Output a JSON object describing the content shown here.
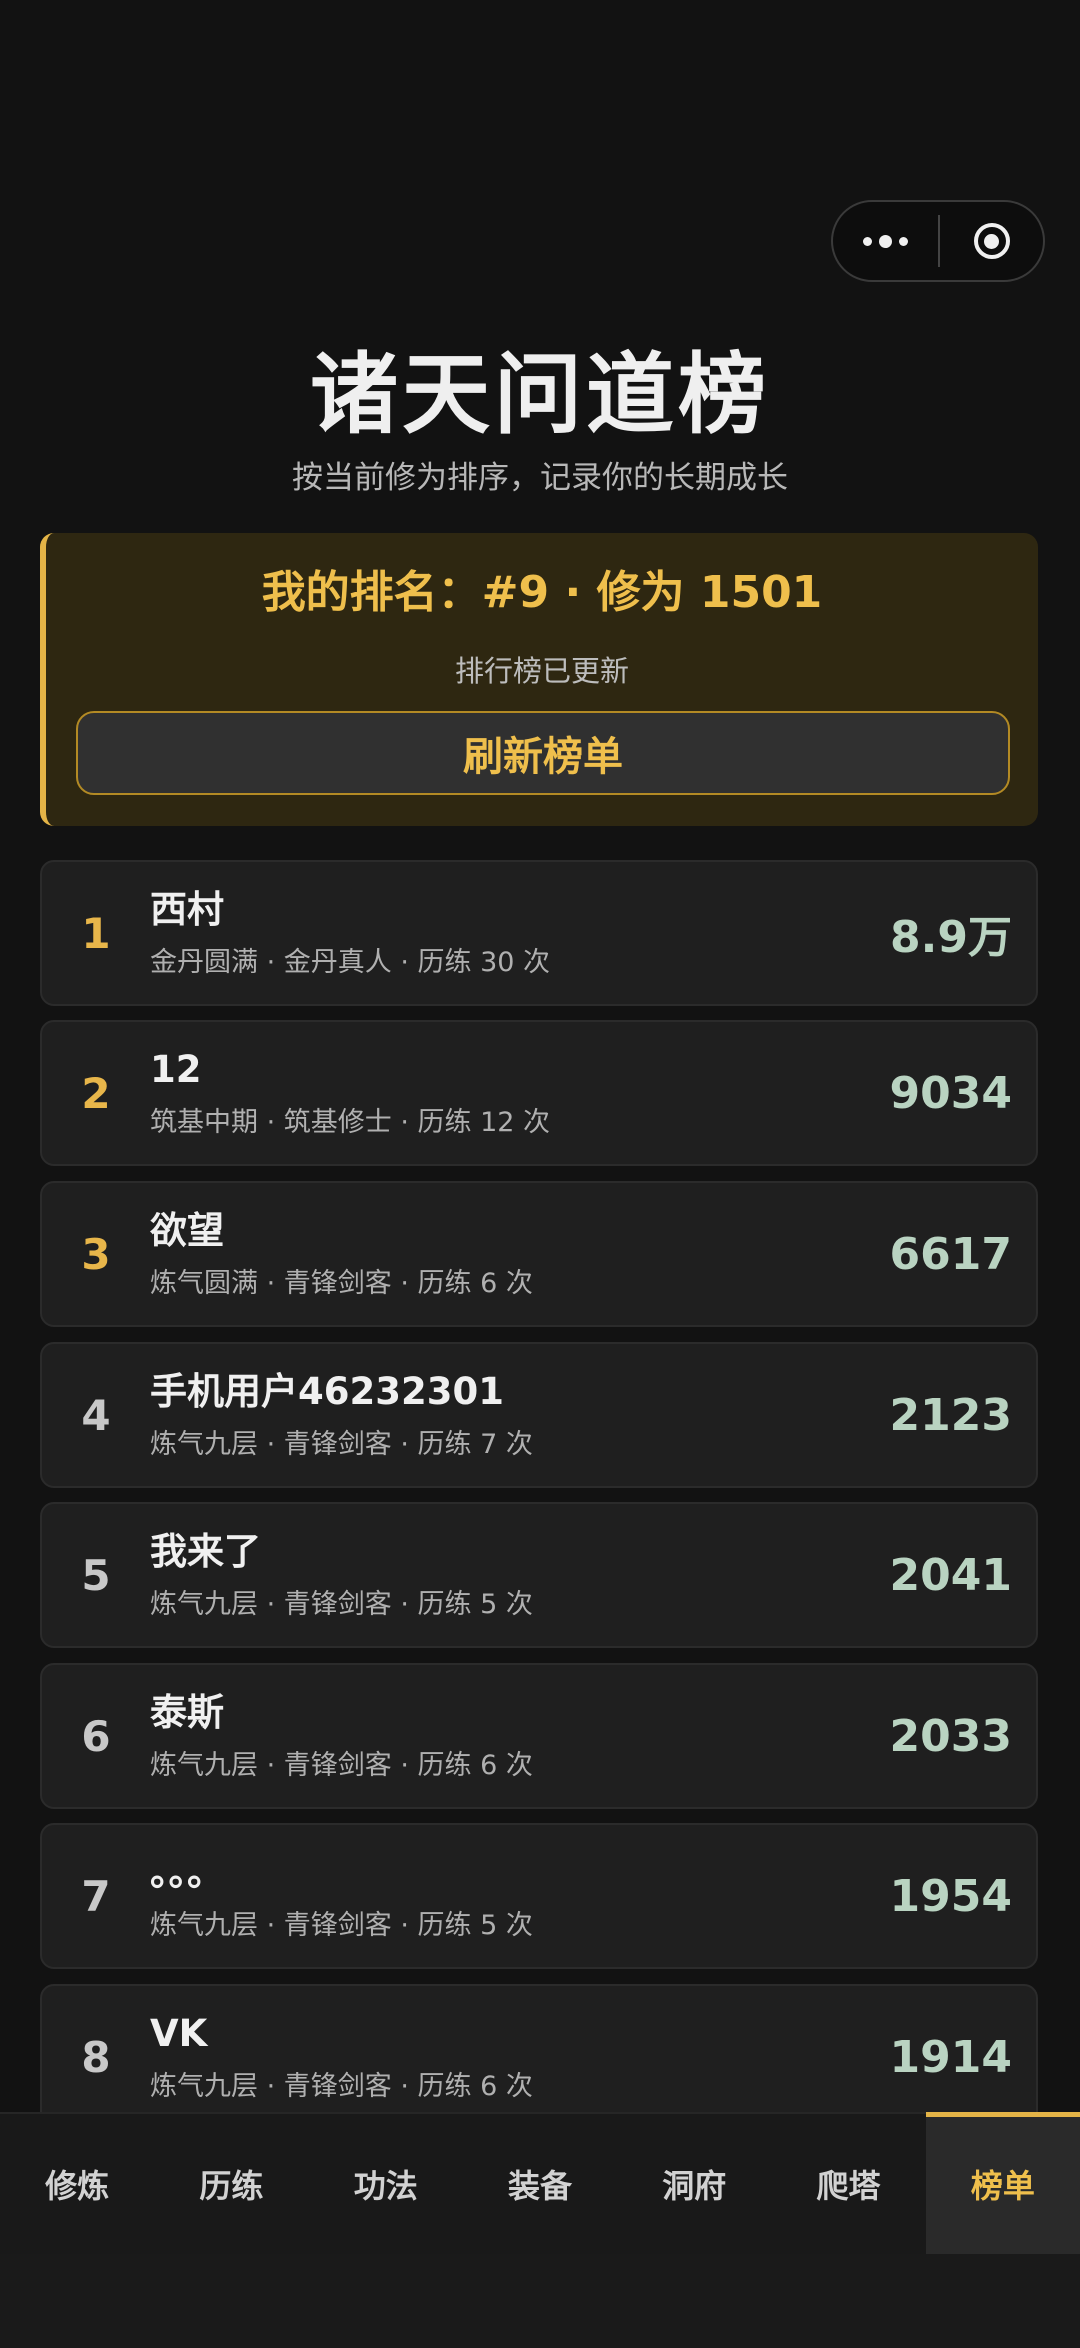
{
  "header": {
    "title": "诸天问道榜",
    "subtitle": "按当前修为排序，记录你的长期成长"
  },
  "my_rank": {
    "text": "我的排名：#9 · 修为 1501",
    "status": "排行榜已更新",
    "refresh_label": "刷新榜单"
  },
  "leaderboard": [
    {
      "rank": "1",
      "name": "西村",
      "meta": "金丹圆满 · 金丹真人 · 历练 30 次",
      "score": "8.9万"
    },
    {
      "rank": "2",
      "name": "12",
      "meta": "筑基中期 · 筑基修士 · 历练 12 次",
      "score": "9034"
    },
    {
      "rank": "3",
      "name": "欲望",
      "meta": "炼气圆满 · 青锋剑客 · 历练 6 次",
      "score": "6617"
    },
    {
      "rank": "4",
      "name": "手机用户46232301",
      "meta": "炼气九层 · 青锋剑客 · 历练 7 次",
      "score": "2123"
    },
    {
      "rank": "5",
      "name": "我来了",
      "meta": "炼气九层 · 青锋剑客 · 历练 5 次",
      "score": "2041"
    },
    {
      "rank": "6",
      "name": "泰斯",
      "meta": "炼气九层 · 青锋剑客 · 历练 6 次",
      "score": "2033"
    },
    {
      "rank": "7",
      "name": "。。。",
      "meta": "炼气九层 · 青锋剑客 · 历练 5 次",
      "score": "1954"
    },
    {
      "rank": "8",
      "name": "VK",
      "meta": "炼气九层 · 青锋剑客 · 历练 6 次",
      "score": "1914"
    }
  ],
  "tabs": [
    {
      "label": "修炼"
    },
    {
      "label": "历练"
    },
    {
      "label": "功法"
    },
    {
      "label": "装备"
    },
    {
      "label": "洞府"
    },
    {
      "label": "爬塔"
    },
    {
      "label": "榜单",
      "active": true
    }
  ],
  "colors": {
    "accent_gold": "#efbf4c",
    "score_green": "#b9d3c1",
    "background": "#121212"
  },
  "icons": {
    "capsule_more": "more-dots-icon",
    "capsule_close": "target-circle-icon"
  }
}
